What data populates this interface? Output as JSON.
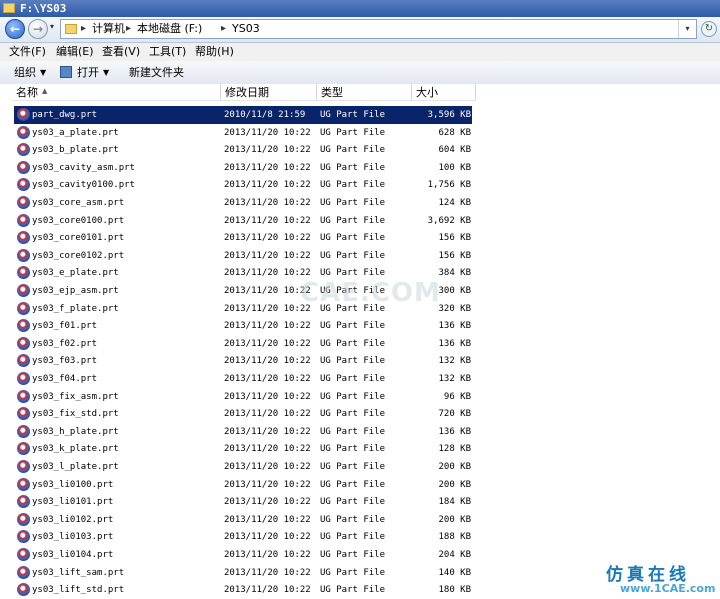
{
  "window": {
    "title": "F:\\YS03"
  },
  "address": {
    "crumbs": [
      "计算机",
      "本地磁盘 (F:)",
      "YS03"
    ],
    "separator": "▸"
  },
  "menu": [
    "文件(F)",
    "编辑(E)",
    "查看(V)",
    "工具(T)",
    "帮助(H)"
  ],
  "toolbar": {
    "organize": "组织",
    "open": "打开",
    "new_folder": "新建文件夹"
  },
  "columns": {
    "name": "名称",
    "date": "修改日期",
    "type": "类型",
    "size": "大小"
  },
  "files": [
    {
      "name": "part_dwg.prt",
      "date": "2010/11/8 21:59",
      "type": "UG Part File",
      "size": "3,596 KB",
      "selected": true
    },
    {
      "name": "ys03_a_plate.prt",
      "date": "2013/11/20 10:22",
      "type": "UG Part File",
      "size": "628 KB"
    },
    {
      "name": "ys03_b_plate.prt",
      "date": "2013/11/20 10:22",
      "type": "UG Part File",
      "size": "604 KB"
    },
    {
      "name": "ys03_cavity_asm.prt",
      "date": "2013/11/20 10:22",
      "type": "UG Part File",
      "size": "100 KB"
    },
    {
      "name": "ys03_cavity0100.prt",
      "date": "2013/11/20 10:22",
      "type": "UG Part File",
      "size": "1,756 KB"
    },
    {
      "name": "ys03_core_asm.prt",
      "date": "2013/11/20 10:22",
      "type": "UG Part File",
      "size": "124 KB"
    },
    {
      "name": "ys03_core0100.prt",
      "date": "2013/11/20 10:22",
      "type": "UG Part File",
      "size": "3,692 KB"
    },
    {
      "name": "ys03_core0101.prt",
      "date": "2013/11/20 10:22",
      "type": "UG Part File",
      "size": "156 KB"
    },
    {
      "name": "ys03_core0102.prt",
      "date": "2013/11/20 10:22",
      "type": "UG Part File",
      "size": "156 KB"
    },
    {
      "name": "ys03_e_plate.prt",
      "date": "2013/11/20 10:22",
      "type": "UG Part File",
      "size": "384 KB"
    },
    {
      "name": "ys03_ejp_asm.prt",
      "date": "2013/11/20 10:22",
      "type": "UG Part File",
      "size": "300 KB"
    },
    {
      "name": "ys03_f_plate.prt",
      "date": "2013/11/20 10:22",
      "type": "UG Part File",
      "size": "320 KB"
    },
    {
      "name": "ys03_f01.prt",
      "date": "2013/11/20 10:22",
      "type": "UG Part File",
      "size": "136 KB"
    },
    {
      "name": "ys03_f02.prt",
      "date": "2013/11/20 10:22",
      "type": "UG Part File",
      "size": "136 KB"
    },
    {
      "name": "ys03_f03.prt",
      "date": "2013/11/20 10:22",
      "type": "UG Part File",
      "size": "132 KB"
    },
    {
      "name": "ys03_f04.prt",
      "date": "2013/11/20 10:22",
      "type": "UG Part File",
      "size": "132 KB"
    },
    {
      "name": "ys03_fix_asm.prt",
      "date": "2013/11/20 10:22",
      "type": "UG Part File",
      "size": "96 KB"
    },
    {
      "name": "ys03_fix_std.prt",
      "date": "2013/11/20 10:22",
      "type": "UG Part File",
      "size": "720 KB"
    },
    {
      "name": "ys03_h_plate.prt",
      "date": "2013/11/20 10:22",
      "type": "UG Part File",
      "size": "136 KB"
    },
    {
      "name": "ys03_k_plate.prt",
      "date": "2013/11/20 10:22",
      "type": "UG Part File",
      "size": "128 KB"
    },
    {
      "name": "ys03_l_plate.prt",
      "date": "2013/11/20 10:22",
      "type": "UG Part File",
      "size": "200 KB"
    },
    {
      "name": "ys03_li0100.prt",
      "date": "2013/11/20 10:22",
      "type": "UG Part File",
      "size": "200 KB"
    },
    {
      "name": "ys03_li0101.prt",
      "date": "2013/11/20 10:22",
      "type": "UG Part File",
      "size": "184 KB"
    },
    {
      "name": "ys03_li0102.prt",
      "date": "2013/11/20 10:22",
      "type": "UG Part File",
      "size": "200 KB"
    },
    {
      "name": "ys03_li0103.prt",
      "date": "2013/11/20 10:22",
      "type": "UG Part File",
      "size": "188 KB"
    },
    {
      "name": "ys03_li0104.prt",
      "date": "2013/11/20 10:22",
      "type": "UG Part File",
      "size": "204 KB"
    },
    {
      "name": "ys03_lift_sam.prt",
      "date": "2013/11/20 10:22",
      "type": "UG Part File",
      "size": "140 KB"
    },
    {
      "name": "ys03_lift_std.prt",
      "date": "2013/11/20 10:22",
      "type": "UG Part File",
      "size": "180 KB"
    }
  ],
  "watermark": {
    "faint": "CAE.COM",
    "brand": "仿真在线",
    "url": "www.1CAE.com"
  },
  "colors": {
    "selection": "#0a246a",
    "titlebar": "#2f5aa8"
  }
}
